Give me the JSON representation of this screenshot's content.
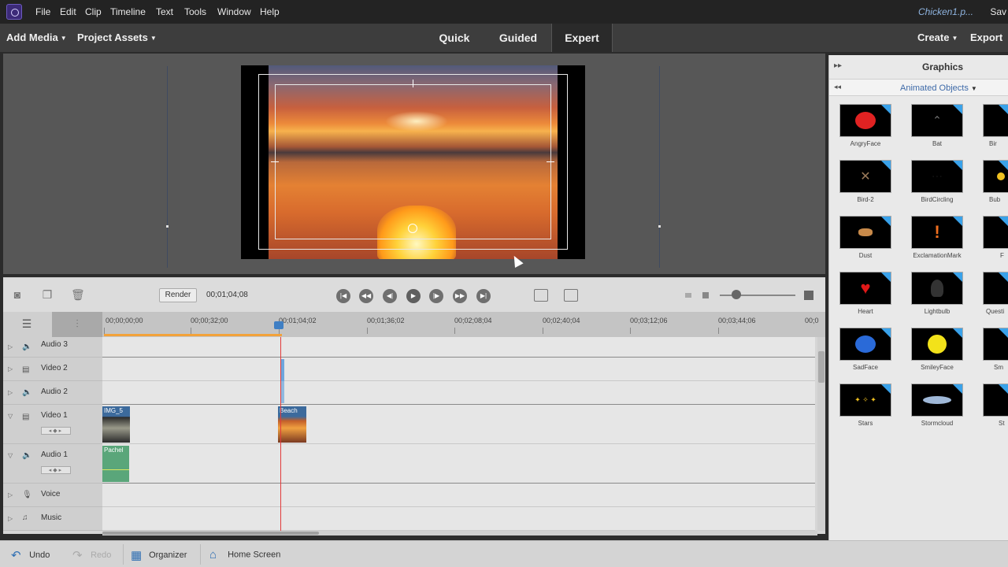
{
  "menu": {
    "items": [
      "File",
      "Edit",
      "Clip",
      "Timeline",
      "Text",
      "Tools",
      "Window",
      "Help"
    ],
    "document_title": "Chicken1.p...",
    "save": "Sav"
  },
  "modebar": {
    "add_media": "Add Media",
    "project_assets": "Project Assets",
    "tabs": [
      "Quick",
      "Guided",
      "Expert"
    ],
    "active_tab": "Expert",
    "create": "Create",
    "export": "Export"
  },
  "timeline": {
    "render_label": "Render",
    "timecode": "00;01;04;08",
    "ruler_labels": [
      "00;00;00;00",
      "00;00;32;00",
      "00;01;04;02",
      "00;01;36;02",
      "00;02;08;04",
      "00;02;40;04",
      "00;03;12;06",
      "00;03;44;06",
      "00;0"
    ],
    "tracks": [
      {
        "name": "Audio 3",
        "icon": "speaker-icon"
      },
      {
        "name": "Video 2",
        "icon": "film-icon"
      },
      {
        "name": "Audio 2",
        "icon": "speaker-icon"
      },
      {
        "name": "Video 1",
        "icon": "film-icon"
      },
      {
        "name": "Audio 1",
        "icon": "speaker-icon"
      },
      {
        "name": "Voice",
        "icon": "microphone-icon"
      },
      {
        "name": "Music",
        "icon": "music-note-icon"
      }
    ],
    "clips": {
      "video1_a": "IMG_5",
      "video1_b": "Beach",
      "audio1_a": "Pachel"
    }
  },
  "graphics": {
    "title": "Graphics",
    "category": "Animated Objects",
    "items": [
      "AngryFace",
      "Bat",
      "Bird-2",
      "BirdCircling",
      "Dust",
      "ExclamationMark",
      "Heart",
      "Lightbulb",
      "SadFace",
      "SmileyFace",
      "Stars",
      "Stormcloud"
    ],
    "partial_items": [
      "Bir",
      "Bub",
      "F",
      "Questi",
      "Sm",
      "St"
    ]
  },
  "bottombar": {
    "undo": "Undo",
    "redo": "Redo",
    "organizer": "Organizer",
    "home_screen": "Home Screen"
  },
  "colors": {
    "menubar_bg": "#232323",
    "accent_blue": "#3aa2ea",
    "playhead_red": "#e23a3a",
    "work_area_orange": "#f2a23a"
  }
}
